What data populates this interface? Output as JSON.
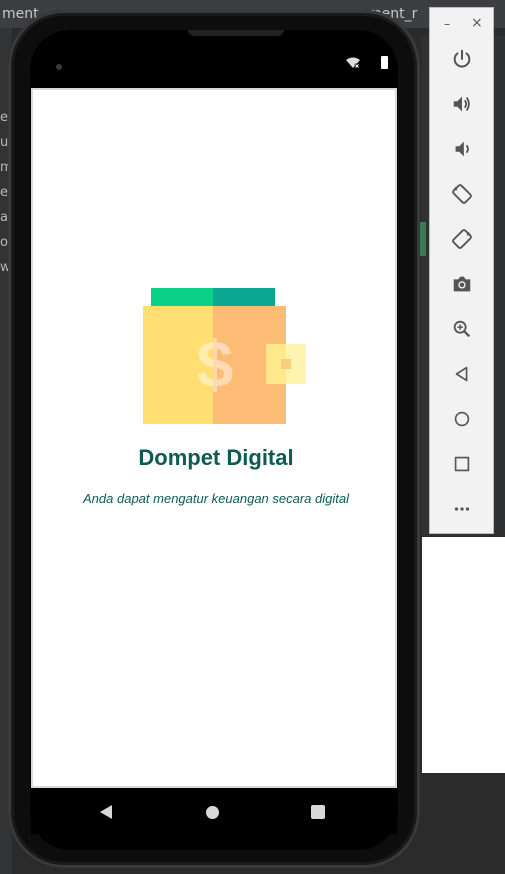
{
  "ide": {
    "tab_left": "ment_",
    "tab_right": "ment_r",
    "side_letters": [
      "e",
      "u",
      "m",
      "e",
      "a",
      "o",
      "w"
    ]
  },
  "app": {
    "title": "Dompet Digital",
    "subtitle": "Anda dapat mengatur keuangan secara digital",
    "logo_glyph": "$"
  },
  "toolbar": {
    "minimize_label": "–",
    "close_label": "×",
    "items": [
      {
        "name": "power-icon"
      },
      {
        "name": "volume-up-icon"
      },
      {
        "name": "volume-down-icon"
      },
      {
        "name": "rotate-left-icon"
      },
      {
        "name": "rotate-right-icon"
      },
      {
        "name": "camera-icon"
      },
      {
        "name": "zoom-icon"
      },
      {
        "name": "back-icon"
      },
      {
        "name": "home-icon"
      },
      {
        "name": "overview-icon"
      },
      {
        "name": "more-icon"
      }
    ]
  },
  "colors": {
    "title": "#0c5c52",
    "wallet_yellow": "#ffdf72",
    "wallet_orange": "#fdbc75",
    "wallet_green": "#0bd186",
    "wallet_teal": "#0aa891"
  }
}
